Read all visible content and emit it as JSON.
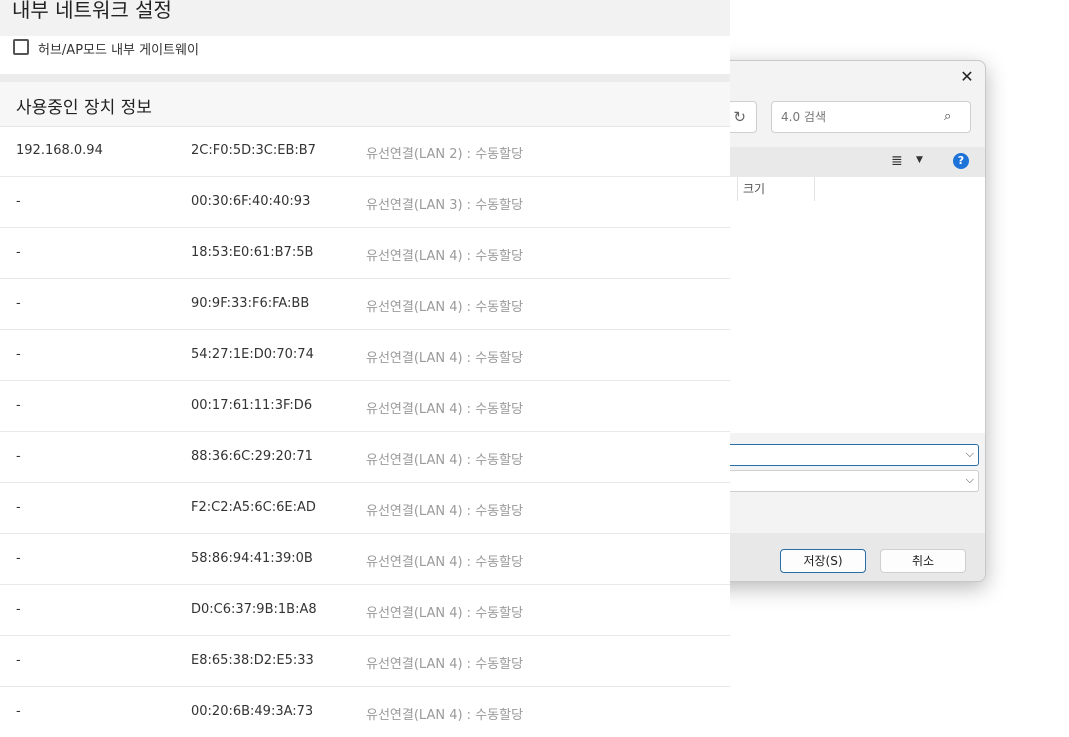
{
  "page": {
    "title": "내부 네트워크 설정",
    "hub_checkbox_label": "허브/AP모드 내부 게이트웨이",
    "hub_checked": false,
    "section_title": "사용중인 장치 정보"
  },
  "devices": [
    {
      "ip": "192.168.0.94",
      "mac": "2C:F0:5D:3C:EB:B7",
      "connection": "유선연결(LAN 2) : 수동할당"
    },
    {
      "ip": "-",
      "mac": "00:30:6F:40:40:93",
      "connection": "유선연결(LAN 3) : 수동할당"
    },
    {
      "ip": "-",
      "mac": "18:53:E0:61:B7:5B",
      "connection": "유선연결(LAN 4) : 수동할당"
    },
    {
      "ip": "-",
      "mac": "90:9F:33:F6:FA:BB",
      "connection": "유선연결(LAN 4) : 수동할당"
    },
    {
      "ip": "-",
      "mac": "54:27:1E:D0:70:74",
      "connection": "유선연결(LAN 4) : 수동할당"
    },
    {
      "ip": "-",
      "mac": "00:17:61:11:3F:D6",
      "connection": "유선연결(LAN 4) : 수동할당"
    },
    {
      "ip": "-",
      "mac": "88:36:6C:29:20:71",
      "connection": "유선연결(LAN 4) : 수동할당"
    },
    {
      "ip": "-",
      "mac": "F2:C2:A5:6C:6E:AD",
      "connection": "유선연결(LAN 4) : 수동할당"
    },
    {
      "ip": "-",
      "mac": "58:86:94:41:39:0B",
      "connection": "유선연결(LAN 4) : 수동할당"
    },
    {
      "ip": "-",
      "mac": "D0:C6:37:9B:1B:A8",
      "connection": "유선연결(LAN 4) : 수동할당"
    },
    {
      "ip": "-",
      "mac": "E8:65:38:D2:E5:33",
      "connection": "유선연결(LAN 4) : 수동할당"
    },
    {
      "ip": "-",
      "mac": "00:20:6B:49:3A:73",
      "connection": "유선연결(LAN 4) : 수동할당"
    }
  ],
  "dialog": {
    "search_placeholder": "4.0 검색",
    "column_size": "크기",
    "save_label": "저장(S)",
    "cancel_label": "취소",
    "close_glyph": "✕",
    "refresh_glyph": "↻",
    "search_glyph": "⌕",
    "view_glyph": "≣",
    "view_caret_glyph": "▼",
    "help_glyph": "?",
    "chevron_glyph": "⌵",
    "icons": {
      "close": "close-icon",
      "refresh": "refresh-icon",
      "search": "search-icon",
      "view": "view-options-icon",
      "help": "help-icon"
    },
    "accent_color": "#2a6ea6",
    "help_color": "#1e73d8"
  }
}
